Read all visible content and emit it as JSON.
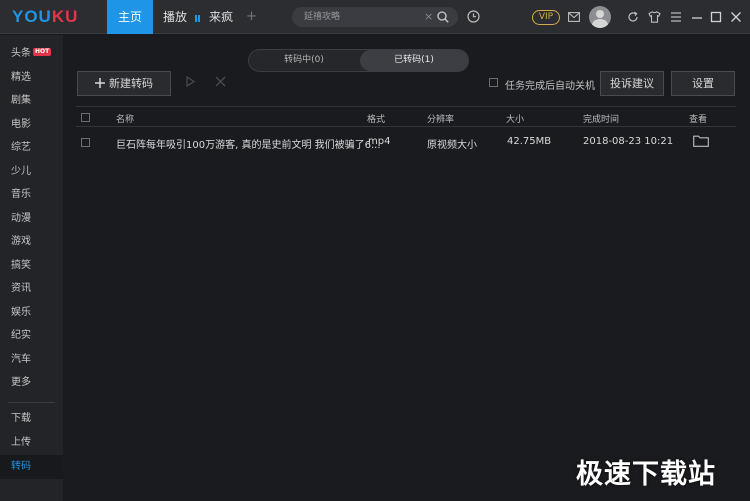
{
  "app": {
    "logo_you": "YOU",
    "logo_ku": "KU"
  },
  "nav": {
    "tabs": [
      "主页",
      "播放",
      "来疯"
    ],
    "plus": "+"
  },
  "search": {
    "placeholder": "延禧攻略",
    "clear": "×"
  },
  "header": {
    "vip": "VIP"
  },
  "sidebar": {
    "items": [
      "头条",
      "精选",
      "剧集",
      "电影",
      "综艺",
      "少儿",
      "音乐",
      "动漫",
      "游戏",
      "搞笑",
      "资讯",
      "娱乐",
      "纪实",
      "汽车",
      "更多"
    ],
    "hot_badge": "HOT",
    "bottom_items": [
      "下载",
      "上传",
      "转码"
    ],
    "active": "转码"
  },
  "transcode": {
    "tabs": [
      "转码中(0)",
      "已转码(1)"
    ],
    "active_tab": "已转码(1)",
    "new_button": "新建转码",
    "auto_shutdown_label": "任务完成后自动关机",
    "feedback_button": "投诉建议",
    "settings_button": "设置",
    "columns": [
      "名称",
      "格式",
      "分辨率",
      "大小",
      "完成时间",
      "查看"
    ],
    "rows": [
      {
        "name": "巨石阵每年吸引100万游客, 真的是史前文明 我们被骗了6...",
        "format": "mp4",
        "resolution": "原视频大小",
        "size": "42.75MB",
        "completed": "2018-08-23 10:21"
      }
    ]
  },
  "watermark": "极速下载站",
  "colors": {
    "accent": "#1e95e6",
    "brand_red": "#e4334b",
    "vip_gold": "#d8a84a",
    "background": "#1a1b1f"
  }
}
